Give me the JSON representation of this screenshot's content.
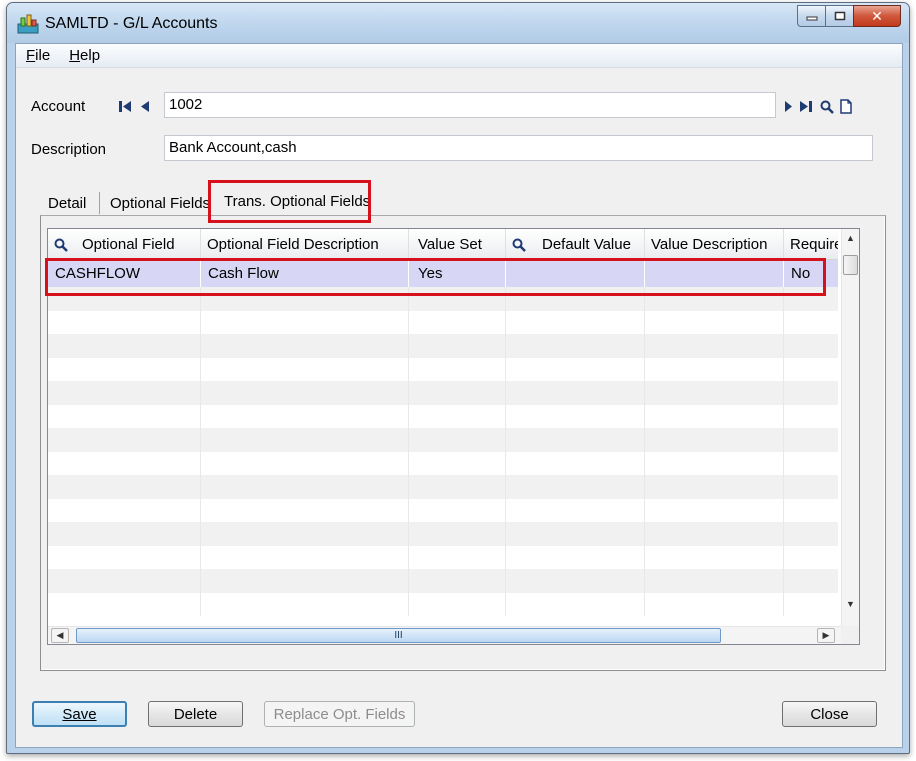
{
  "window": {
    "title": "SAMLTD - G/L Accounts",
    "caption_buttons": {
      "minimize": "—",
      "maximize": "□",
      "close": "✕"
    }
  },
  "menu": {
    "items": [
      {
        "label": "File",
        "accel": "F",
        "rest": "ile"
      },
      {
        "label": "Help",
        "accel": "H",
        "rest": "elp"
      }
    ]
  },
  "form": {
    "account_label": "Account",
    "account_value": "1002",
    "description_label": "Description",
    "description_value": "Bank Account,cash"
  },
  "tabs": [
    {
      "label": "Detail",
      "active": false
    },
    {
      "label": "Optional Fields",
      "active": false
    },
    {
      "label": "Trans. Optional Fields",
      "active": true
    }
  ],
  "grid": {
    "columns": [
      "Optional Field",
      "Optional Field Description",
      "Value Set",
      "Default Value",
      "Value Description",
      "Require"
    ],
    "rows": [
      [
        "CASHFLOW",
        "Cash Flow",
        "Yes",
        "",
        "",
        "No"
      ]
    ],
    "hscroll_grip": "III"
  },
  "buttons": {
    "save": "Save",
    "delete": "Delete",
    "replace": "Replace Opt. Fields",
    "close": "Close"
  },
  "colors": {
    "highlight_red": "#d6101c",
    "selected_row": "#d7d7f5"
  }
}
